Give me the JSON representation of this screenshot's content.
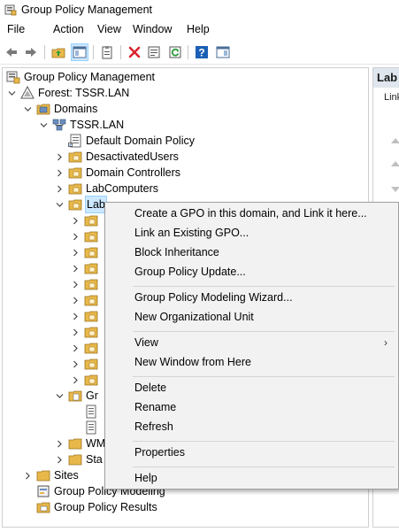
{
  "window": {
    "title": "Group Policy Management"
  },
  "menu": [
    "File",
    "Action",
    "View",
    "Window",
    "Help"
  ],
  "toolbar": {
    "icons": [
      "back-arrow-icon",
      "forward-arrow-icon",
      "up-folder-icon",
      "show-hide-console-tree-icon",
      "clipboard-icon",
      "delete-x-icon",
      "properties-icon",
      "refresh-icon",
      "help-icon",
      "panel-icon"
    ],
    "colors": {
      "delete": "#d9232c",
      "help": "#1c5fb6",
      "refresh": "#2c9a3c",
      "folder": "#e8b84a"
    }
  },
  "tree": {
    "root": "Group Policy Management",
    "forest": "Forest: TSSR.LAN",
    "domains": "Domains",
    "domain": "TSSR.LAN",
    "items": [
      "Default Domain Policy",
      "DesactivatedUsers",
      "Domain Controllers",
      "LabComputers"
    ],
    "selected": "LabUsers",
    "selected_visible": "Lab",
    "partial": {
      "gr": "Gr",
      "wm": "WM",
      "sta": "Sta"
    },
    "sites": "Sites",
    "modeling": "Group Policy Modeling",
    "results": "Group Policy Results"
  },
  "right_pane": {
    "title": "Lab",
    "tab": "Link"
  },
  "context_menu": {
    "items": [
      "Create a GPO in this domain, and Link it here...",
      "Link an Existing GPO...",
      "Block Inheritance",
      "Group Policy Update...",
      "Group Policy Modeling Wizard...",
      "New Organizational Unit",
      "View",
      "New Window from Here",
      "Delete",
      "Rename",
      "Refresh",
      "Properties",
      "Help"
    ],
    "submenu_glyph": "›"
  }
}
